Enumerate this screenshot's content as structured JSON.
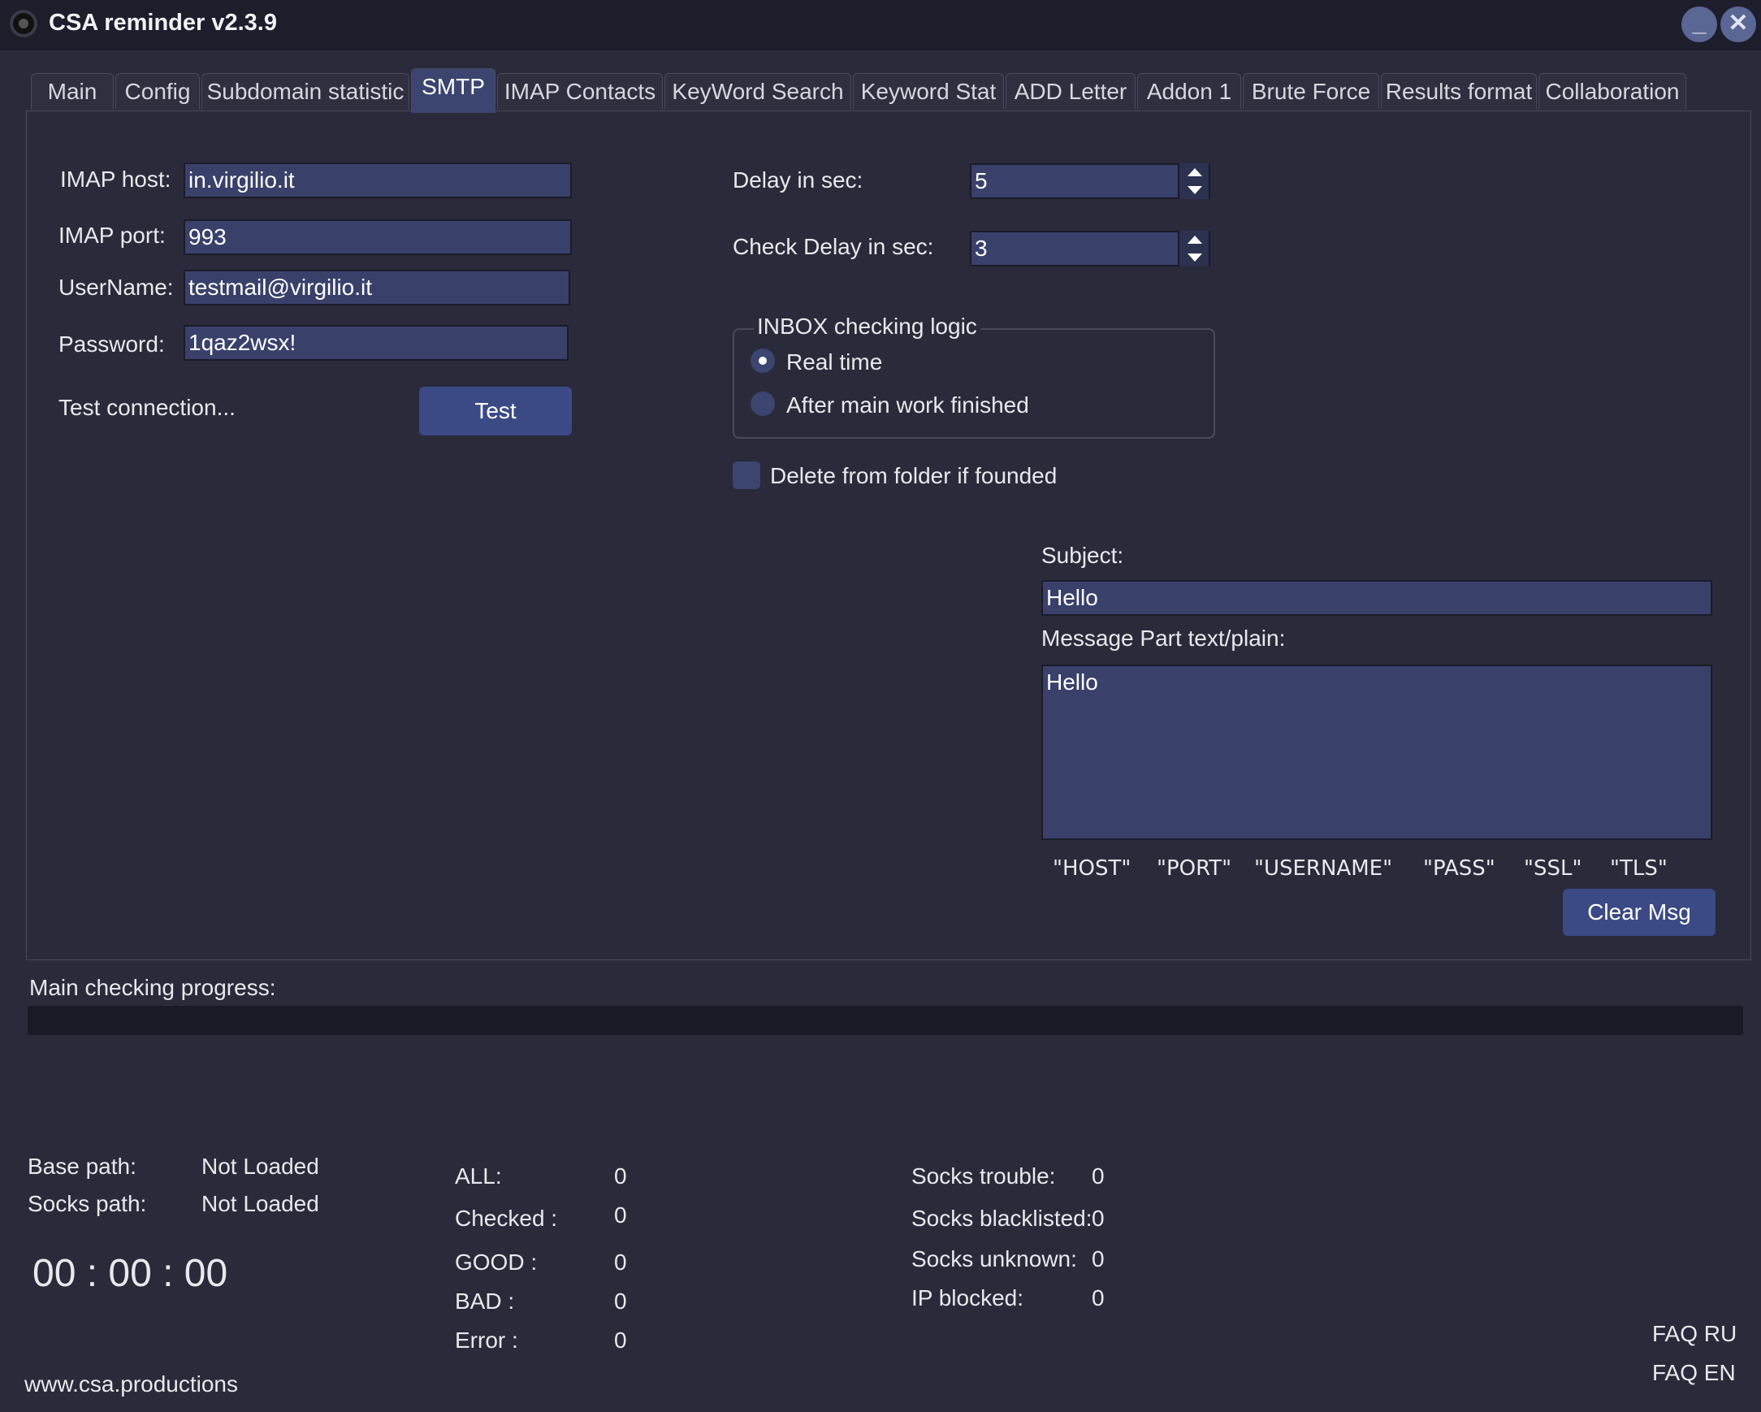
{
  "window": {
    "title": "CSA reminder v2.3.9",
    "minimize_label": "_",
    "close_label": "✕"
  },
  "tabs": [
    {
      "label": "Main"
    },
    {
      "label": "Config"
    },
    {
      "label": "Subdomain statistic"
    },
    {
      "label": "SMTP"
    },
    {
      "label": "IMAP Contacts"
    },
    {
      "label": "KeyWord Search"
    },
    {
      "label": "Keyword Stat"
    },
    {
      "label": "ADD Letter"
    },
    {
      "label": "Addon 1"
    },
    {
      "label": "Brute Force"
    },
    {
      "label": "Results format"
    },
    {
      "label": "Collaboration"
    }
  ],
  "active_tab": "SMTP",
  "imap": {
    "host_label": "IMAP host:",
    "host_value": "in.virgilio.it",
    "port_label": "IMAP port:",
    "port_value": "993",
    "username_label": "UserName:",
    "username_value": "testmail@virgilio.it",
    "password_label": "Password:",
    "password_value": "1qaz2wsx!",
    "test_label": "Test connection...",
    "test_button": "Test"
  },
  "delay": {
    "delay_label": "Delay in sec:",
    "delay_value": "5",
    "check_delay_label": "Check Delay in sec:",
    "check_delay_value": "3"
  },
  "inbox_logic": {
    "title": "INBOX checking logic",
    "option_realtime": "Real time",
    "option_after": "After main work finished",
    "selected": "Real time"
  },
  "delete_checkbox": {
    "label": "Delete from folder if founded",
    "checked": false
  },
  "message": {
    "subject_label": "Subject:",
    "subject_value": "Hello",
    "body_label": "Message Part text/plain:",
    "body_value": "Hello",
    "macros": [
      "\"HOST\"",
      "\"PORT\"",
      "\"USERNAME\"",
      "\"PASS\"",
      "\"SSL\"",
      "\"TLS\""
    ],
    "clear_button": "Clear Msg"
  },
  "progress": {
    "label": "Main checking progress:",
    "fraction": 0
  },
  "paths": {
    "base_label": "Base path:",
    "base_value": "Not Loaded",
    "socks_label": "Socks path:",
    "socks_value": "Not Loaded"
  },
  "timer": "00 : 00 : 00",
  "stats": {
    "all_label": "ALL:",
    "all_value": "0",
    "checked_label": "Checked :",
    "checked_value": "0",
    "good_label": "GOOD :",
    "good_value": "0",
    "bad_label": "BAD :",
    "bad_value": "0",
    "error_label": "Error :",
    "error_value": "0"
  },
  "socks": {
    "trouble_label": "Socks trouble:",
    "trouble_value": "0",
    "blacklisted_label": "Socks blacklisted:",
    "blacklisted_value": "0",
    "unknown_label": "Socks unknown:",
    "unknown_value": "0",
    "ip_blocked_label": "IP blocked:",
    "ip_blocked_value": "0"
  },
  "footer": {
    "website": "www.csa.productions",
    "faq_ru": "FAQ RU",
    "faq_en": "FAQ EN"
  }
}
